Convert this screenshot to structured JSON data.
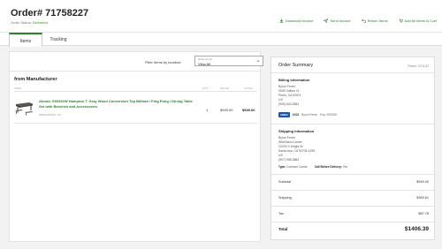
{
  "order": {
    "title": "Order# 71758227",
    "status_label": "Order Status:",
    "status_value": "Delivered"
  },
  "actions": [
    {
      "label": "Download Invoice",
      "icon": "download-icon"
    },
    {
      "label": "Send Invoice",
      "icon": "send-icon"
    },
    {
      "label": "Return Items",
      "icon": "return-icon"
    },
    {
      "label": "Add All Items to Cart",
      "icon": "cart-icon"
    }
  ],
  "tabs": {
    "items": "Items",
    "tracking": "Tracking"
  },
  "filter": {
    "label": "Filter Items by location:",
    "select_small_label": "Order Items",
    "select_value": "View All"
  },
  "section": {
    "title": "from Manufacturer"
  },
  "columns": {
    "item": "ITEM",
    "qty": "QTY",
    "price": "PRICE",
    "total": "TOTAL"
  },
  "product": {
    "name": "Atomic G05302W Hampton 7' Gray Wood Conversion Top Billiard / Ping Pong / Dining Table Set with Benches and Accessories",
    "sku": "#3850G05302W - DS",
    "qty": "1",
    "price": "$949.00",
    "total": "$949.00"
  },
  "summary": {
    "title": "Order Summary",
    "placed": "Placed: 07/11/22",
    "billing": {
      "title": "Billing Information",
      "lines": [
        "Byron Ferrer",
        "3035 Sulfton Ct",
        "Perris, CA 92571",
        "US",
        "(909) 543-2884"
      ]
    },
    "payment": {
      "brand": "AMEX",
      "last4": "1002",
      "holder": "Byron Ferrer",
      "expiry": "Exp. 09/2026"
    },
    "shipping": {
      "title": "Shipping Information",
      "lines": [
        "Byron Ferrer",
        "Wild Band Carrier",
        "22203 S Wright St",
        "Santa Ana, CA 92705-2295",
        "US",
        "(907) 998-0884"
      ],
      "type_label": "Type:",
      "type_value": "Common Carrier",
      "call_label": "Call Before Delivery:",
      "call_value": "Yes"
    },
    "subtotal_label": "Subtotal",
    "subtotal": "$949.00",
    "shipping_label": "Shipping",
    "shipping_amount": "$369.61",
    "tax_label": "Tax",
    "tax": "$87.78",
    "total_label": "Total",
    "total": "$1406.39"
  }
}
